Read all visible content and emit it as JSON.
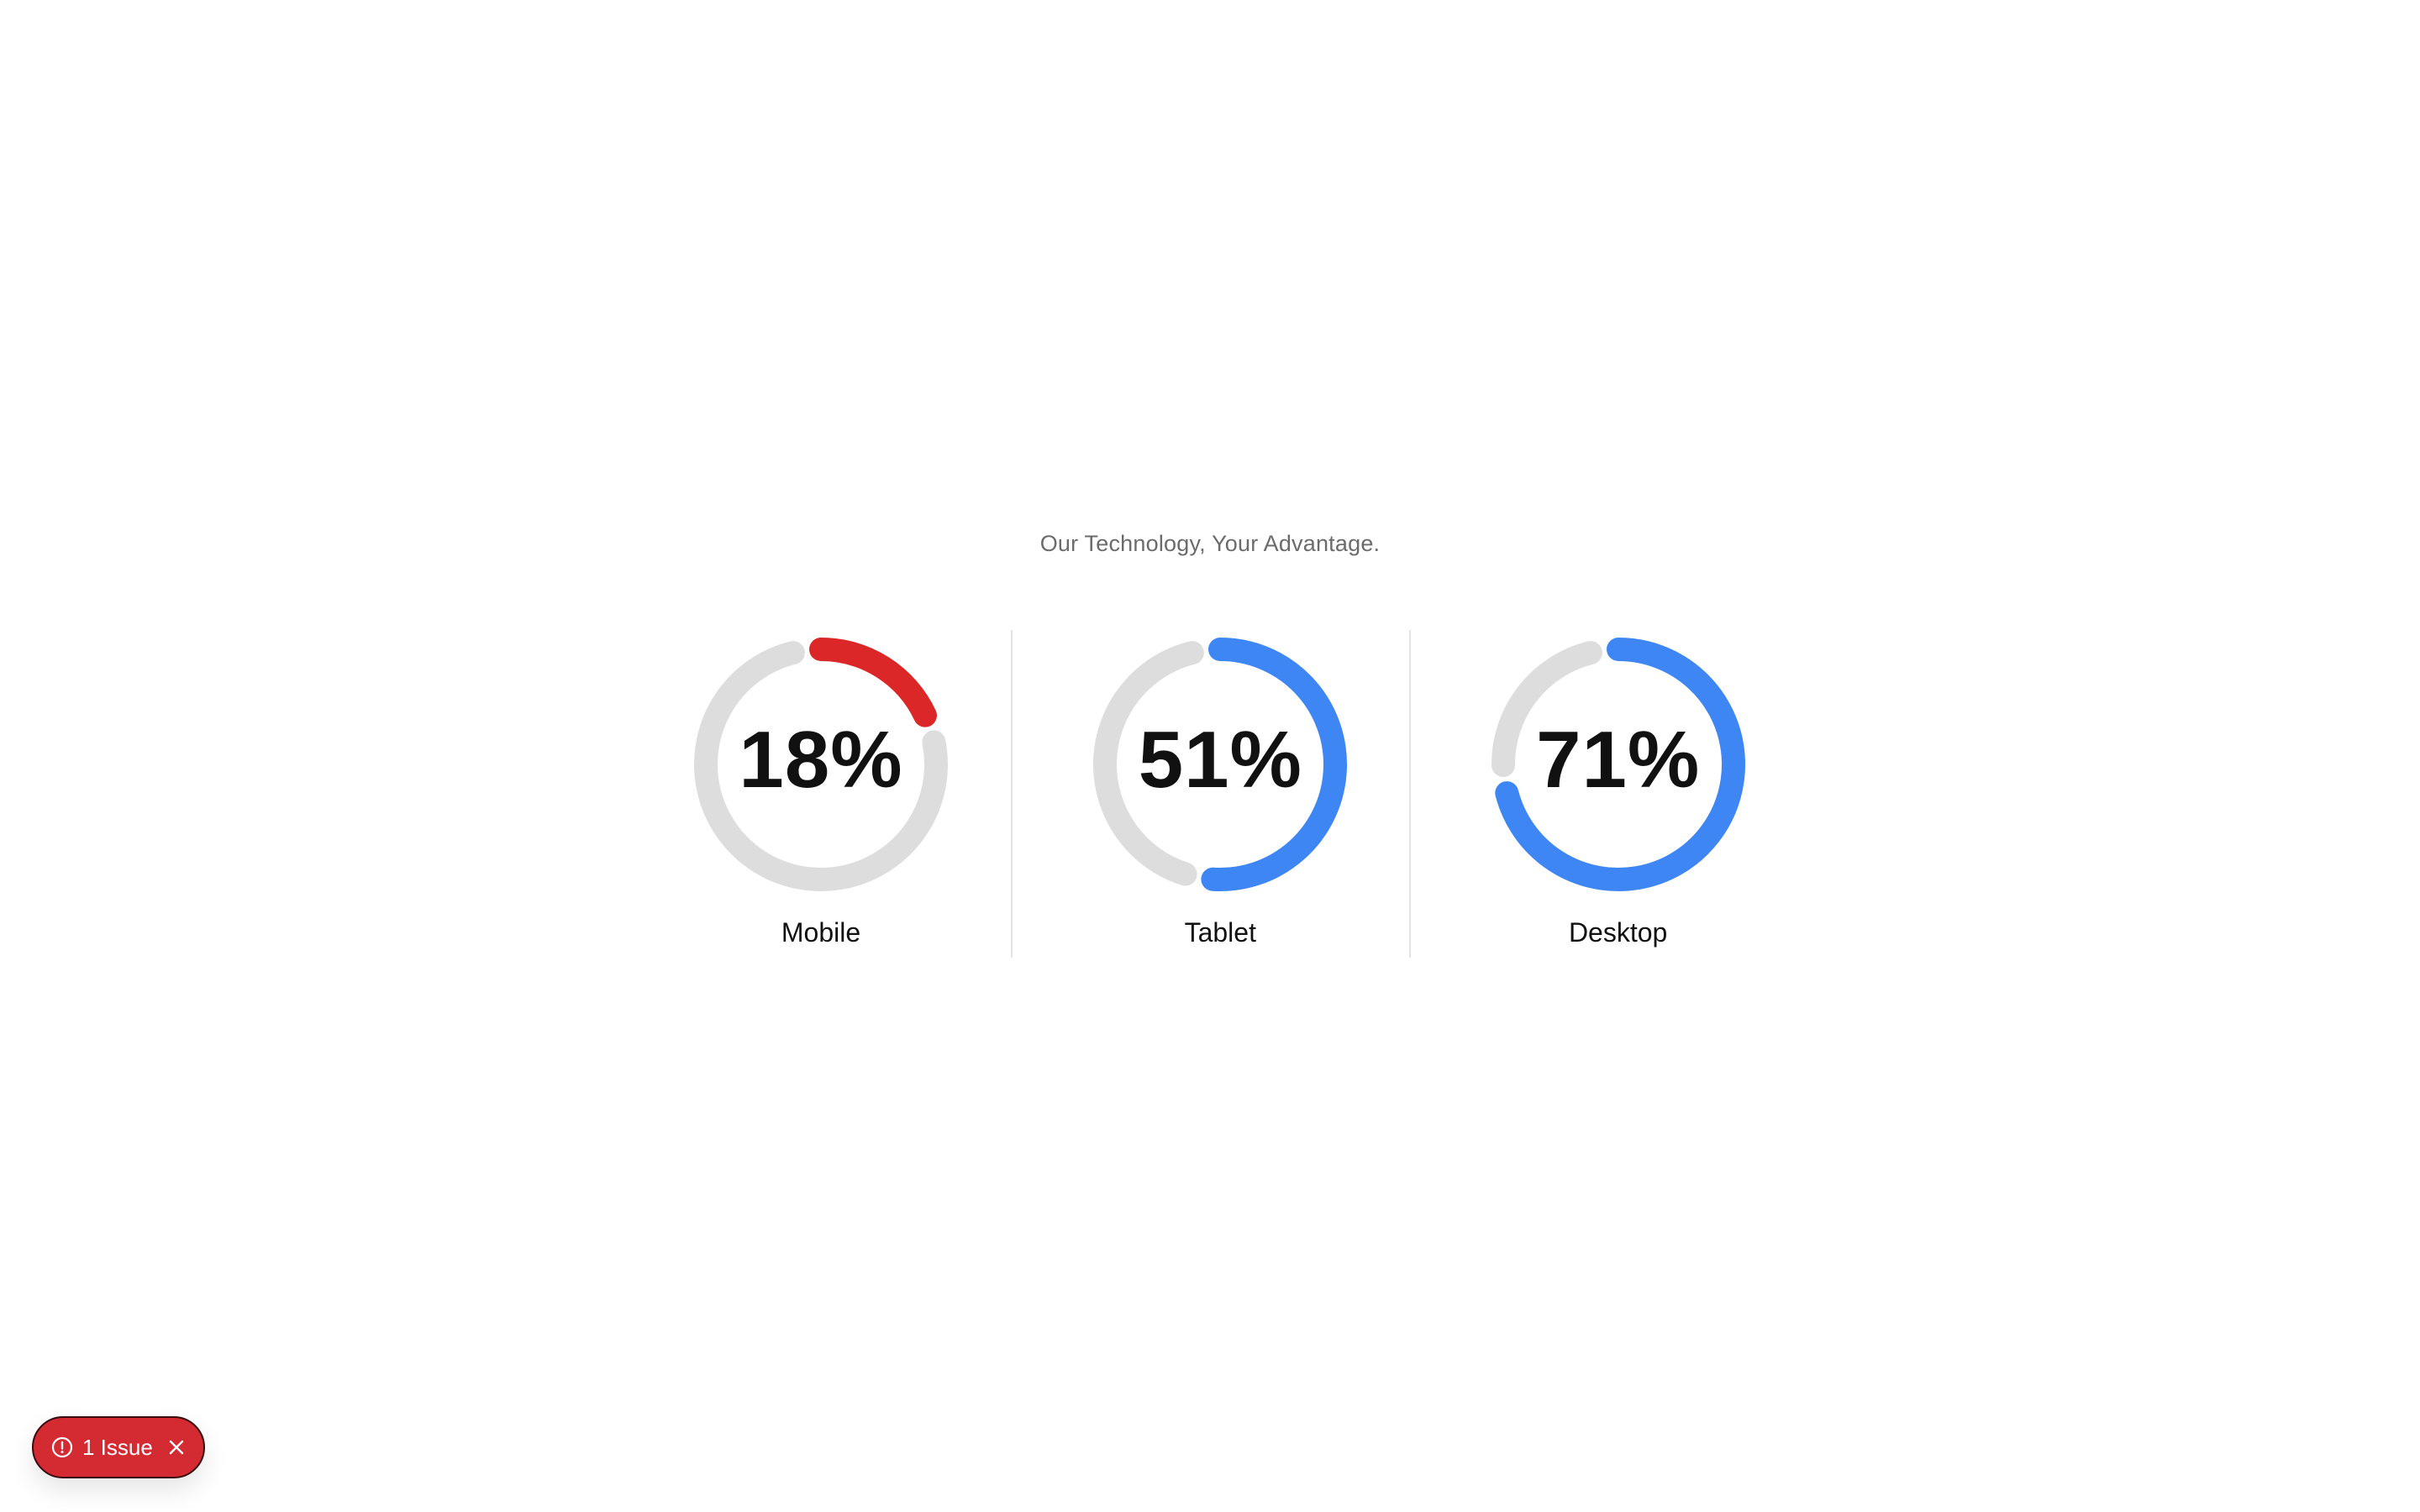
{
  "header": {
    "tagline": "Our Technology, Your Advantage."
  },
  "colors": {
    "track": "#dddddd",
    "low": "#db2727",
    "high": "#3d86f4",
    "pill": "#d42a32"
  },
  "gauges": [
    {
      "label": "Mobile",
      "percent_text": "18%",
      "value": 18,
      "status": "low"
    },
    {
      "label": "Tablet",
      "percent_text": "51%",
      "value": 51,
      "status": "high"
    },
    {
      "label": "Desktop",
      "percent_text": "71%",
      "value": 71,
      "status": "high"
    }
  ],
  "issues_pill": {
    "label": "1 Issue",
    "icon": "alert-circle-icon",
    "close_icon": "close-icon"
  }
}
